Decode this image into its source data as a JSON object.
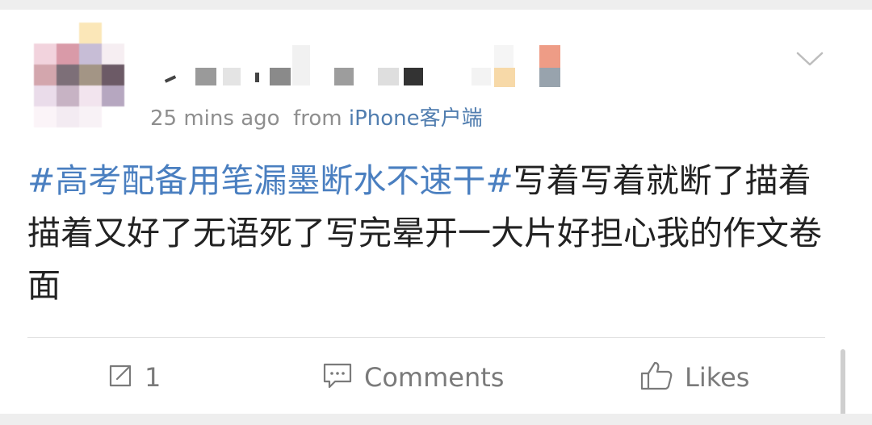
{
  "post": {
    "timestamp": "25 mins ago",
    "from_prefix": "from",
    "source": "iPhone客户端",
    "hashtag": "#高考配备用笔漏墨断水不速干#",
    "body": "写着写着就断了描着描着又好了无语死了写完晕开一大片好担心我的作文卷面"
  },
  "actions": {
    "repost_count": "1",
    "comments_label": "Comments",
    "likes_label": "Likes"
  },
  "icons": {
    "more": "chevron-down-icon",
    "repost": "repost-icon",
    "comments": "comment-icon",
    "likes": "thumbs-up-icon"
  },
  "colors": {
    "hashtag": "#4a7fc0",
    "source_link": "#507daf",
    "meta_text": "#8e8e8e",
    "body_text": "#222222"
  }
}
